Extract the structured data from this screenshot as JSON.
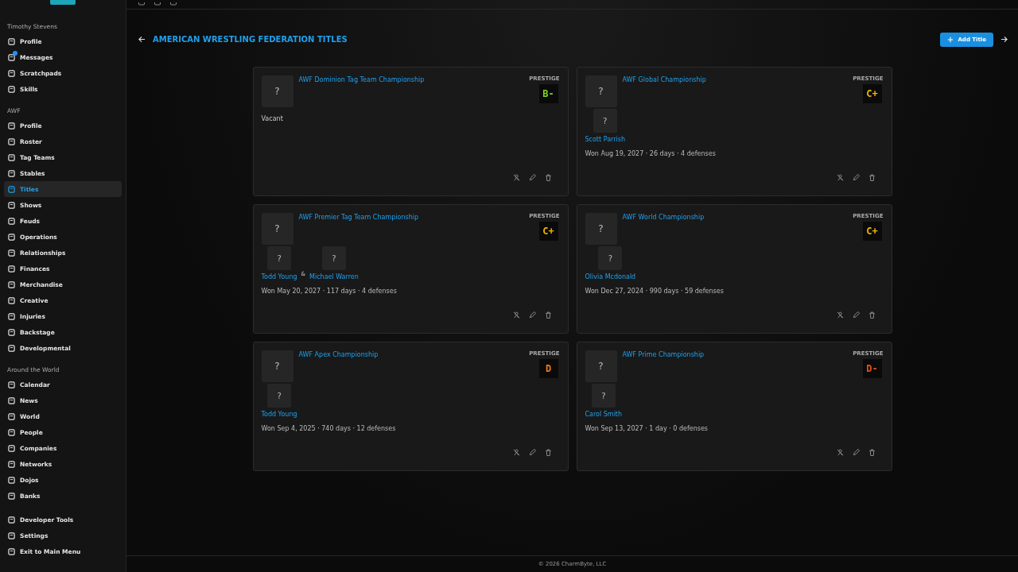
{
  "sidebar": {
    "groups": [
      {
        "heading": "Timothy Stevens",
        "items": [
          {
            "label": "Profile",
            "selected": false
          },
          {
            "label": "Messages",
            "selected": false,
            "badge": true
          },
          {
            "label": "Scratchpads",
            "selected": false
          },
          {
            "label": "Skills",
            "selected": false
          }
        ]
      },
      {
        "heading": "AWF",
        "items": [
          {
            "label": "Profile",
            "selected": false
          },
          {
            "label": "Roster",
            "selected": false
          },
          {
            "label": "Tag Teams",
            "selected": false
          },
          {
            "label": "Stables",
            "selected": false
          },
          {
            "label": "Titles",
            "selected": true
          },
          {
            "label": "Shows",
            "selected": false
          },
          {
            "label": "Feuds",
            "selected": false
          },
          {
            "label": "Operations",
            "selected": false
          },
          {
            "label": "Relationships",
            "selected": false
          },
          {
            "label": "Finances",
            "selected": false
          },
          {
            "label": "Merchandise",
            "selected": false
          },
          {
            "label": "Creative",
            "selected": false
          },
          {
            "label": "Injuries",
            "selected": false
          },
          {
            "label": "Backstage",
            "selected": false
          },
          {
            "label": "Developmental",
            "selected": false
          }
        ]
      },
      {
        "heading": "Around the World",
        "items": [
          {
            "label": "Calendar",
            "selected": false
          },
          {
            "label": "News",
            "selected": false
          },
          {
            "label": "World",
            "selected": false
          },
          {
            "label": "People",
            "selected": false
          },
          {
            "label": "Companies",
            "selected": false
          },
          {
            "label": "Networks",
            "selected": false
          },
          {
            "label": "Dojos",
            "selected": false
          },
          {
            "label": "Banks",
            "selected": false
          }
        ]
      },
      {
        "items": [
          {
            "label": "Developer Tools",
            "selected": false
          },
          {
            "label": "Settings",
            "selected": false
          },
          {
            "label": "Exit to Main Menu",
            "selected": false
          }
        ]
      }
    ]
  },
  "page": {
    "title": "AMERICAN WRESTLING FEDERATION TITLES",
    "add_button": "Add Title"
  },
  "titles": [
    {
      "name": "AWF Dominion Tag Team Championship",
      "prestige_label": "PRESTIGE",
      "grade": "B-",
      "color": "#7ed321",
      "kind": "vacant",
      "vacant_text": "Vacant"
    },
    {
      "name": "AWF Global Championship",
      "prestige_label": "PRESTIGE",
      "grade": "C+",
      "color": "#f5b800",
      "kind": "held",
      "holders": [
        {
          "avatar": "?",
          "name": "Scott Parrish"
        }
      ],
      "record": "Won Aug 19, 2027 · 26 days · 4 defenses"
    },
    {
      "name": "AWF Premier Tag Team Championship",
      "prestige_label": "PRESTIGE",
      "grade": "C+",
      "color": "#f5b800",
      "kind": "held",
      "holders": [
        {
          "avatar": "?",
          "name": "Todd Young"
        },
        {
          "avatar": "?",
          "name": "Michael Warren"
        }
      ],
      "separator": "&",
      "record": "Won May 20, 2027 · 117 days · 4 defenses"
    },
    {
      "name": "AWF World Championship",
      "prestige_label": "PRESTIGE",
      "grade": "C+",
      "color": "#f5b800",
      "kind": "held",
      "holders": [
        {
          "avatar": "?",
          "name": "Olivia Mcdonald"
        }
      ],
      "record": "Won Dec 27, 2024 · 990 days · 59 defenses"
    },
    {
      "name": "AWF Apex Championship",
      "prestige_label": "PRESTIGE",
      "grade": "D",
      "color": "#f07a1a",
      "kind": "held",
      "holders": [
        {
          "avatar": "?",
          "name": "Todd Young"
        }
      ],
      "record": "Won Sep 4, 2025 · 740 days · 12 defenses"
    },
    {
      "name": "AWF Prime Championship",
      "prestige_label": "PRESTIGE",
      "grade": "D-",
      "color": "#e8501c",
      "kind": "held",
      "holders": [
        {
          "avatar": "?",
          "name": "Carol Smith"
        }
      ],
      "record": "Won Sep 13, 2027 · 1 day · 0 defenses"
    }
  ],
  "title_image": "?",
  "footer": "© 2026 CharmByte, LLC"
}
